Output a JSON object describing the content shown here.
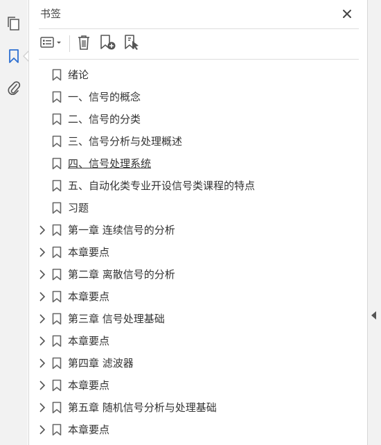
{
  "panel": {
    "title": "书签",
    "close_icon": "close-icon"
  },
  "rail": {
    "items": [
      {
        "name": "pages",
        "icon": "pages-icon"
      },
      {
        "name": "bookmarks",
        "icon": "bookmark-icon",
        "active": true
      },
      {
        "name": "attachments",
        "icon": "paperclip-icon"
      }
    ]
  },
  "toolbar": {
    "icons": [
      "options-menu-icon",
      "delete-icon",
      "new-bookmark-icon",
      "bookmark-from-selection-icon"
    ]
  },
  "bookmarks": [
    {
      "label": "绪论",
      "expandable": false
    },
    {
      "label": "一、信号的概念",
      "expandable": false
    },
    {
      "label": "二、信号的分类",
      "expandable": false
    },
    {
      "label": "三、信号分析与处理概述",
      "expandable": false
    },
    {
      "label": "四、信号处理系统",
      "expandable": false,
      "current": true
    },
    {
      "label": "五、自动化类专业开设信号类课程的特点",
      "expandable": false
    },
    {
      "label": "习题",
      "expandable": false
    },
    {
      "label": "第一章  连续信号的分析",
      "expandable": true
    },
    {
      "label": "本章要点",
      "expandable": true
    },
    {
      "label": "第二章  离散信号的分析",
      "expandable": true
    },
    {
      "label": "本章要点",
      "expandable": true
    },
    {
      "label": "第三章  信号处理基础",
      "expandable": true
    },
    {
      "label": "本章要点",
      "expandable": true
    },
    {
      "label": "第四章  滤波器",
      "expandable": true
    },
    {
      "label": "本章要点",
      "expandable": true
    },
    {
      "label": "第五章  随机信号分析与处理基础",
      "expandable": true
    },
    {
      "label": "本章要点",
      "expandable": true
    }
  ],
  "colors": {
    "accent": "#2d6fd1",
    "icon": "#666666",
    "text": "#333333"
  }
}
